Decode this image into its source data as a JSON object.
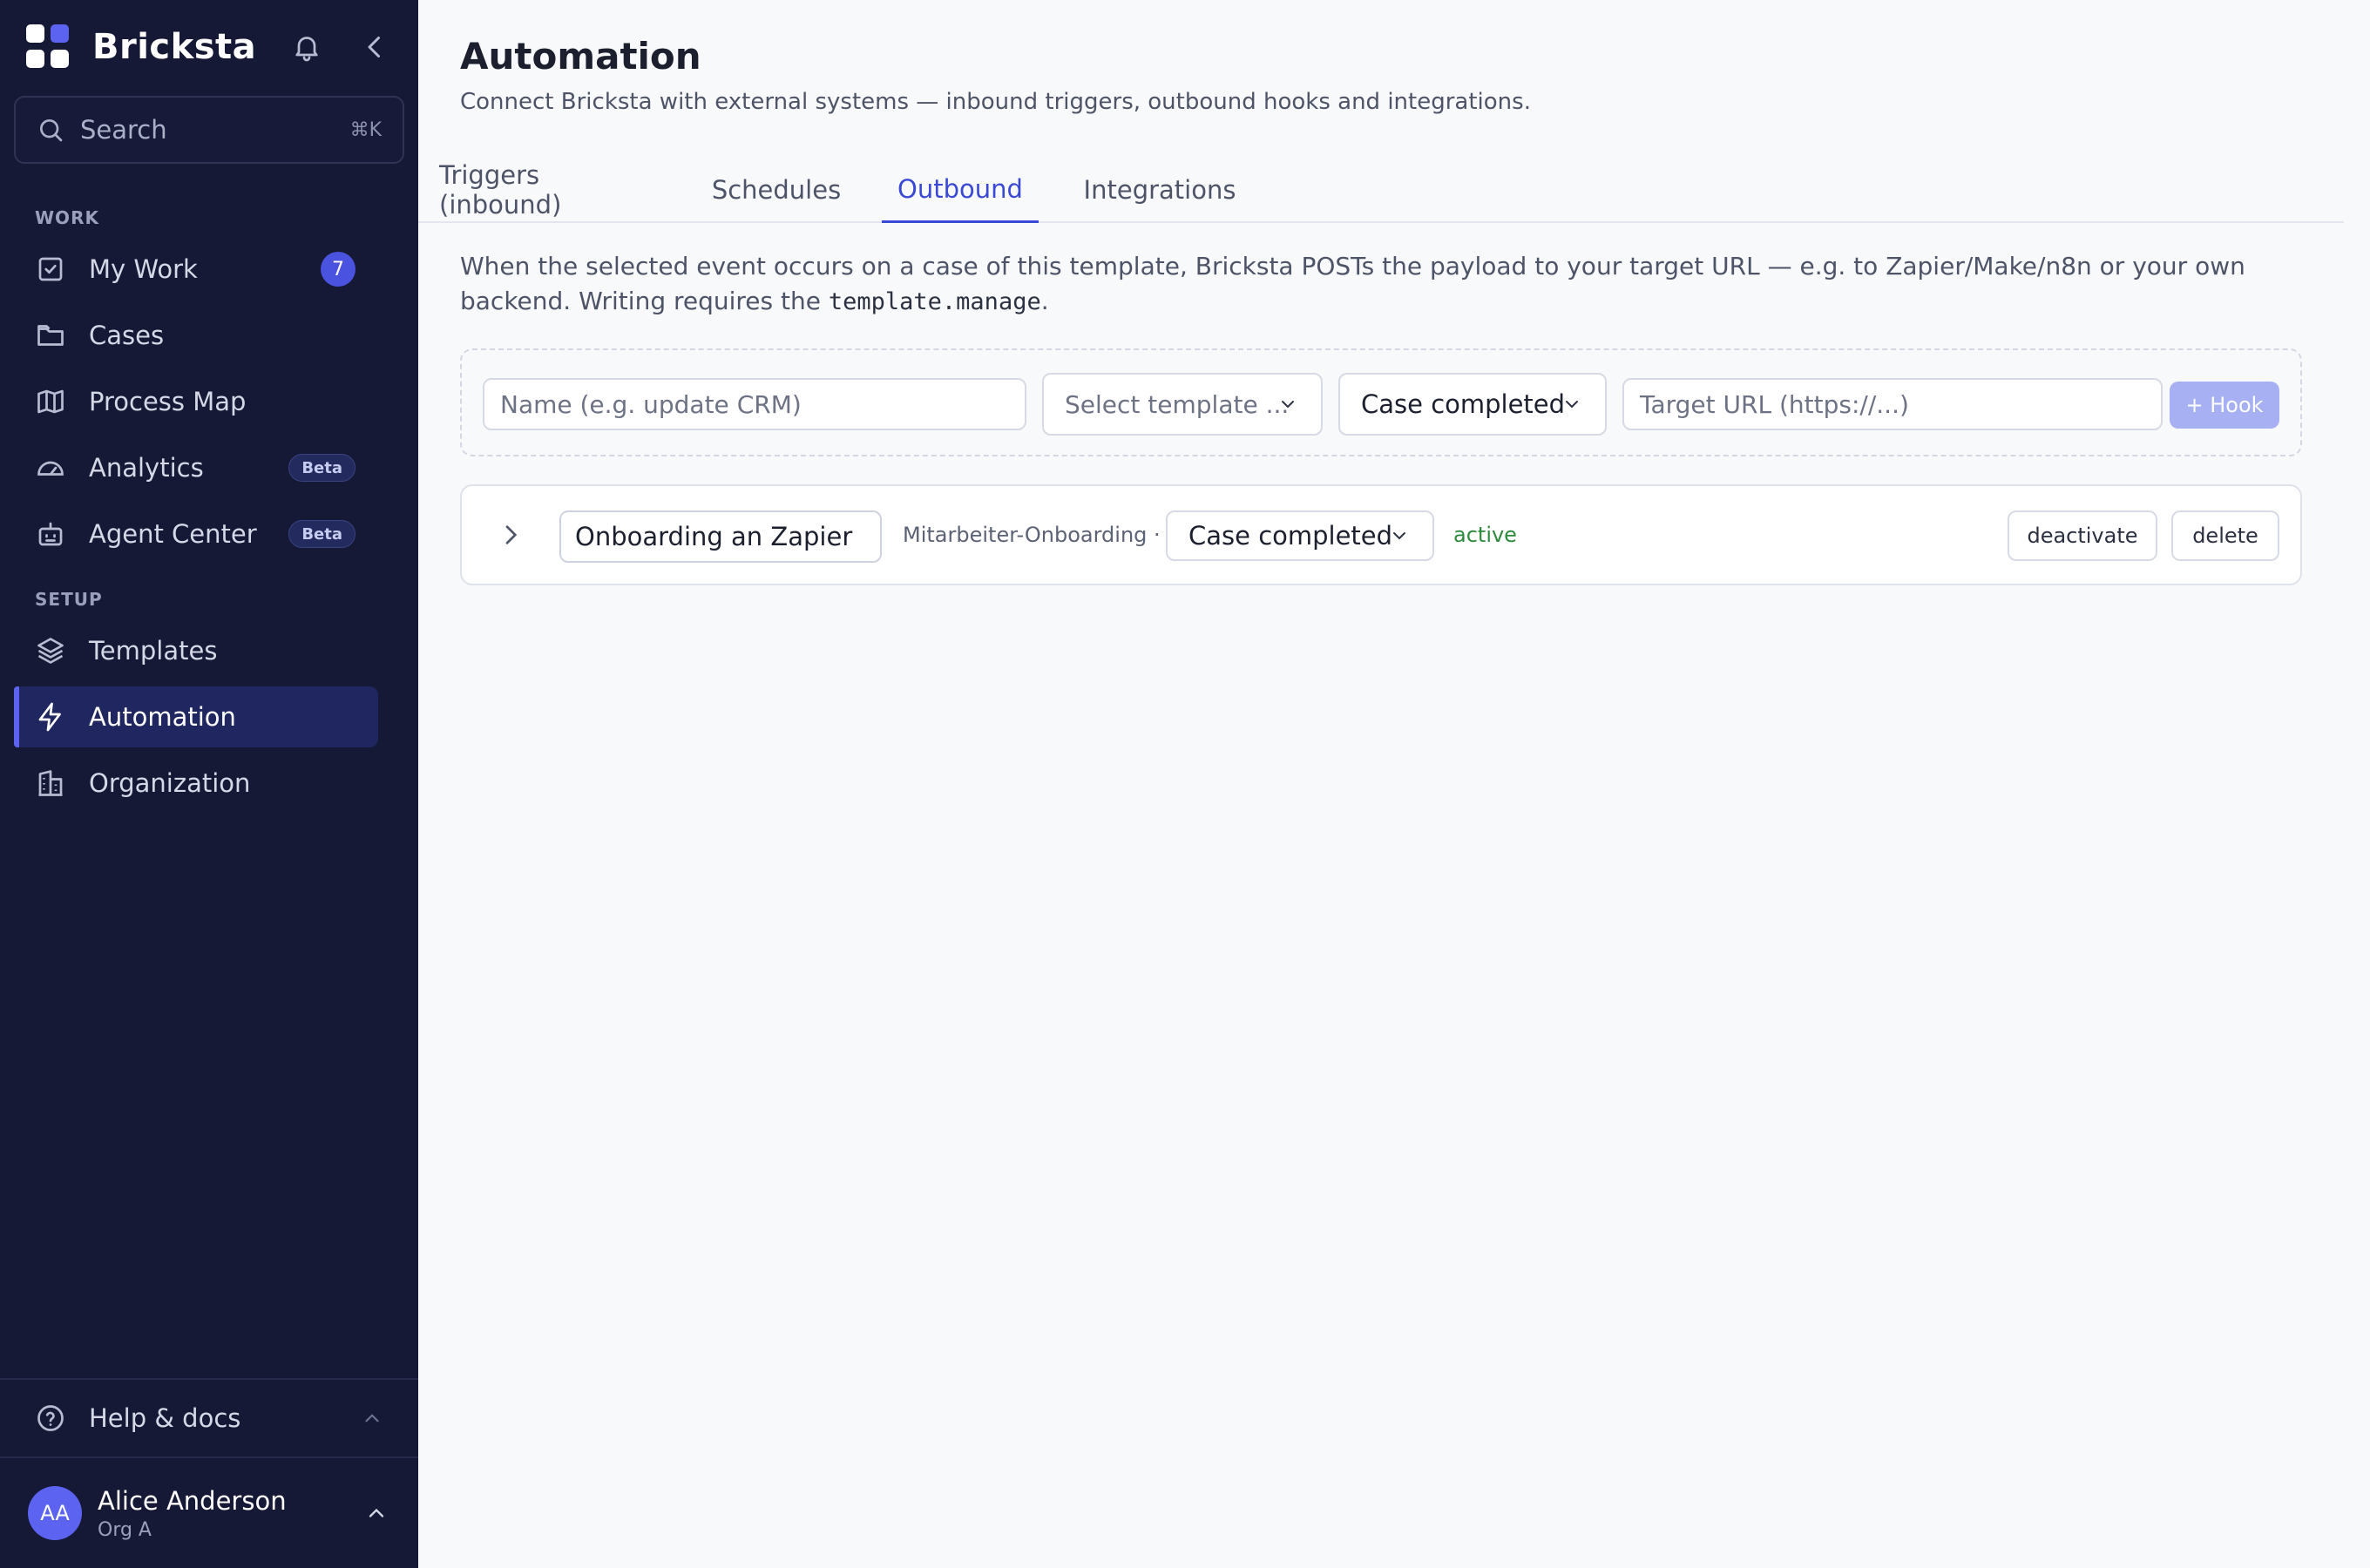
{
  "app": {
    "name": "Bricksta"
  },
  "search": {
    "placeholder": "Search",
    "shortcut": "⌘K"
  },
  "sidebar": {
    "sections": [
      {
        "label": "WORK"
      },
      {
        "label": "SETUP"
      }
    ],
    "items": [
      {
        "label": "My Work",
        "icon": "checkbox-icon",
        "badge": "7"
      },
      {
        "label": "Cases",
        "icon": "folder-icon"
      },
      {
        "label": "Process Map",
        "icon": "map-icon"
      },
      {
        "label": "Analytics",
        "icon": "gauge-icon",
        "badge": "Beta"
      },
      {
        "label": "Agent Center",
        "icon": "robot-icon",
        "badge": "Beta"
      },
      {
        "label": "Templates",
        "icon": "layers-icon"
      },
      {
        "label": "Automation",
        "icon": "bolt-icon",
        "active": true
      },
      {
        "label": "Organization",
        "icon": "building-icon"
      }
    ],
    "help": {
      "label": "Help & docs"
    },
    "user": {
      "initials": "AA",
      "name": "Alice Anderson",
      "org": "Org A"
    }
  },
  "page": {
    "title": "Automation",
    "subtitle": "Connect Bricksta with external systems — inbound triggers, outbound hooks and integrations."
  },
  "tabs": [
    {
      "label": "Triggers (inbound)"
    },
    {
      "label": "Schedules"
    },
    {
      "label": "Outbound",
      "active": true
    },
    {
      "label": "Integrations"
    }
  ],
  "outbound": {
    "description_before": "When the selected event occurs on a case of this template, Bricksta POSTs the payload to your target URL — e.g. to Zapier/Make/n8n or your own backend. Writing requires the ",
    "description_code": "template.manage",
    "description_after": ".",
    "form": {
      "name_placeholder": "Name (e.g. update CRM)",
      "template_placeholder": "Select template ...",
      "event_value": "Case completed",
      "url_placeholder": "Target URL (https://...)",
      "add_label": "+ Hook"
    },
    "hooks": [
      {
        "name": "Onboarding an Zapier",
        "template": "Mitarbeiter-Onboarding ·",
        "event": "Case completed",
        "status": "active",
        "deactivate_label": "deactivate",
        "delete_label": "delete"
      }
    ]
  },
  "colors": {
    "sidebar_bg": "#151935",
    "accent": "#3a49d4",
    "active_status": "#2d8a3c",
    "add_button": "#a6b0f2"
  }
}
